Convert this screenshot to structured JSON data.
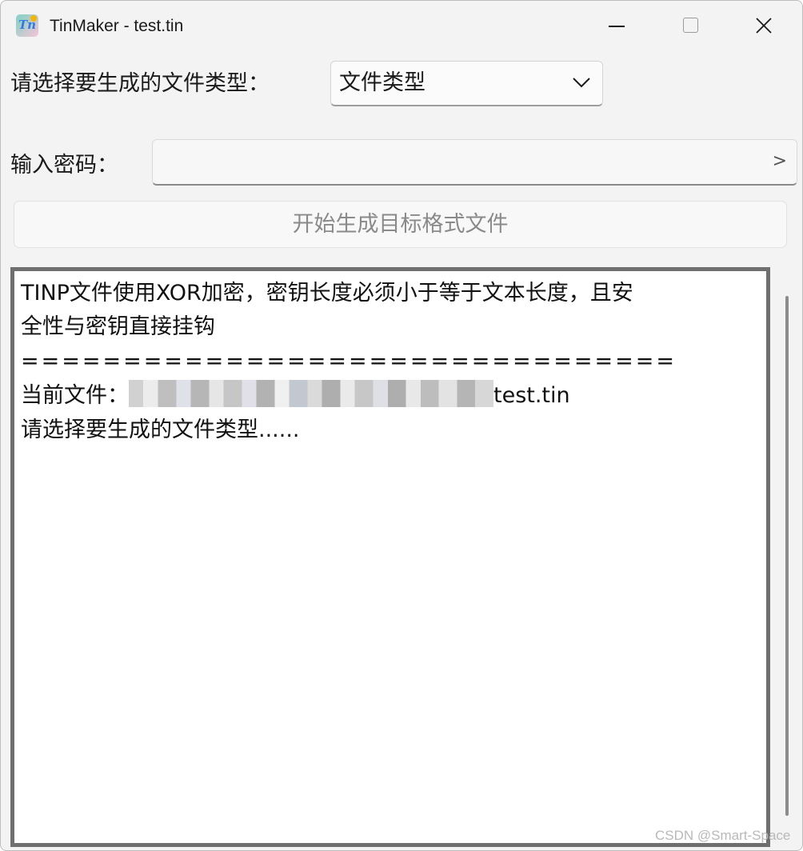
{
  "window": {
    "title": "TinMaker - test.tin",
    "icon": "tinmaker-app-icon"
  },
  "controls": {
    "minimize_icon": "minimize-icon",
    "maximize_icon": "maximize-icon",
    "close_icon": "close-icon"
  },
  "file_type": {
    "label": "请选择要生成的文件类型：",
    "selected": "文件类型",
    "icon": "chevron-down-icon"
  },
  "password": {
    "label": "输入密码：",
    "value": "",
    "reveal_glyph": ">"
  },
  "generate_button": {
    "label": "开始生成目标格式文件"
  },
  "log": {
    "lines": [
      "TINP文件使用XOR加密，密钥长度必须小于等于文本长度，且安",
      "全性与密钥直接挂钩",
      "================================",
      "当前文件：",
      "请选择要生成的文件类型......"
    ],
    "current_file_suffix": "test.tin"
  },
  "watermark": "CSDN @Smart-Space"
}
